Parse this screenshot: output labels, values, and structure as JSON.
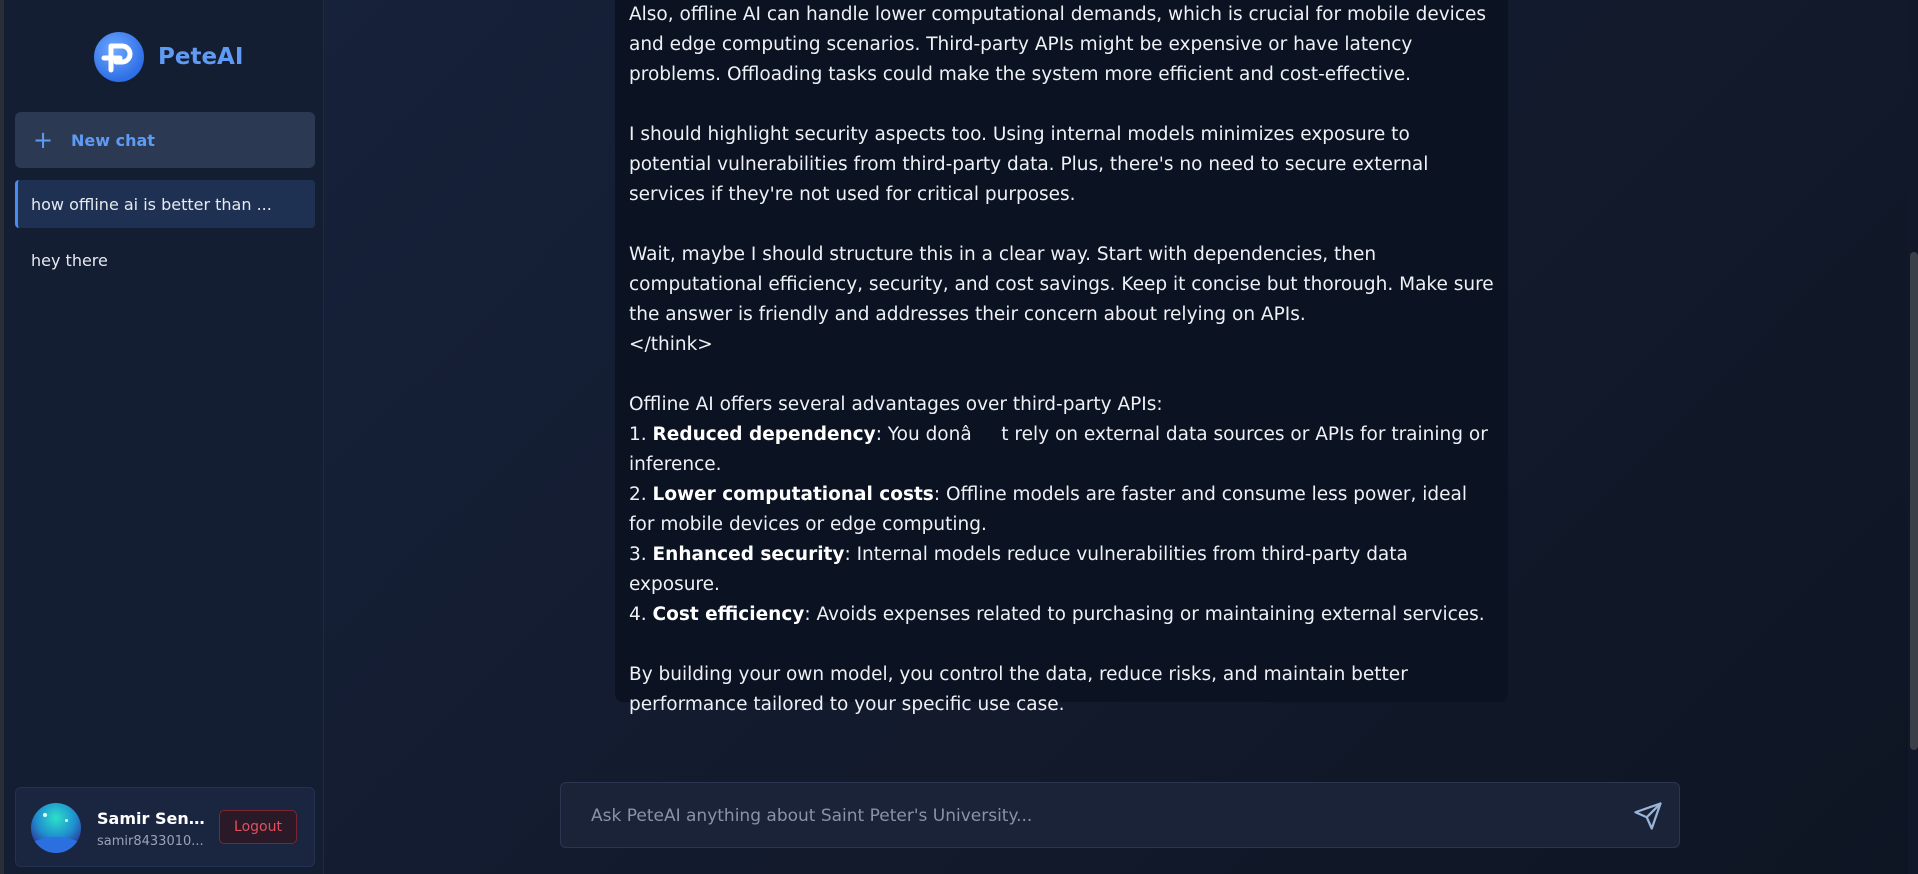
{
  "sidebar": {
    "brand": "PeteAI",
    "new_chat_label": "New chat",
    "chats": [
      {
        "title": "how offline ai is better than ...",
        "active": true
      },
      {
        "title": "hey there",
        "active": false
      }
    ],
    "user": {
      "name": "Samir Seng...",
      "email": "samir8433010...",
      "logout_label": "Logout"
    }
  },
  "message": {
    "paragraphs": [
      "Also, offline AI can handle lower computational demands, which is crucial for mobile devices and edge computing scenarios. Third-party APIs might be expensive or have latency problems. Offloading tasks could make the system more efficient and cost-effective.",
      "I should highlight security aspects too. Using internal models minimizes exposure to potential vulnerabilities from third-party data. Plus, there's no need to secure external services if they're not used for critical purposes.",
      "Wait, maybe I should structure this in a clear way. Start with dependencies, then computational efficiency, security, and cost savings. Keep it concise but thorough. Make sure the answer is friendly and addresses their concern about relying on APIs.",
      "</think>",
      "Offline AI offers several advantages over third-party APIs:"
    ],
    "points": [
      {
        "num": "1. ",
        "title": "Reduced dependency",
        "text": ": You donât rely on external data sources or APIs for training or inference."
      },
      {
        "num": "2. ",
        "title": "Lower computational costs",
        "text": ": Offline models are faster and consume less power, ideal for mobile devices or edge computing."
      },
      {
        "num": "3. ",
        "title": "Enhanced security",
        "text": ": Internal models reduce vulnerabilities from third-party data exposure."
      },
      {
        "num": "4. ",
        "title": "Cost efficiency",
        "text": ": Avoids expenses related to purchasing or maintaining external services."
      }
    ],
    "closing": "By building your own model, you control the data, reduce risks, and maintain better performance tailored to your specific use case."
  },
  "composer": {
    "placeholder": "Ask PeteAI anything about Saint Peter's University...",
    "value": ""
  },
  "icons": {
    "brand_logo": "peteai-logo-icon",
    "new_chat": "plus-icon",
    "send": "send-icon"
  },
  "colors": {
    "accent": "#5f9bf4",
    "sidebar_bg": "#141e33",
    "main_bg": "#121a2c",
    "logout": "#e0505e"
  }
}
